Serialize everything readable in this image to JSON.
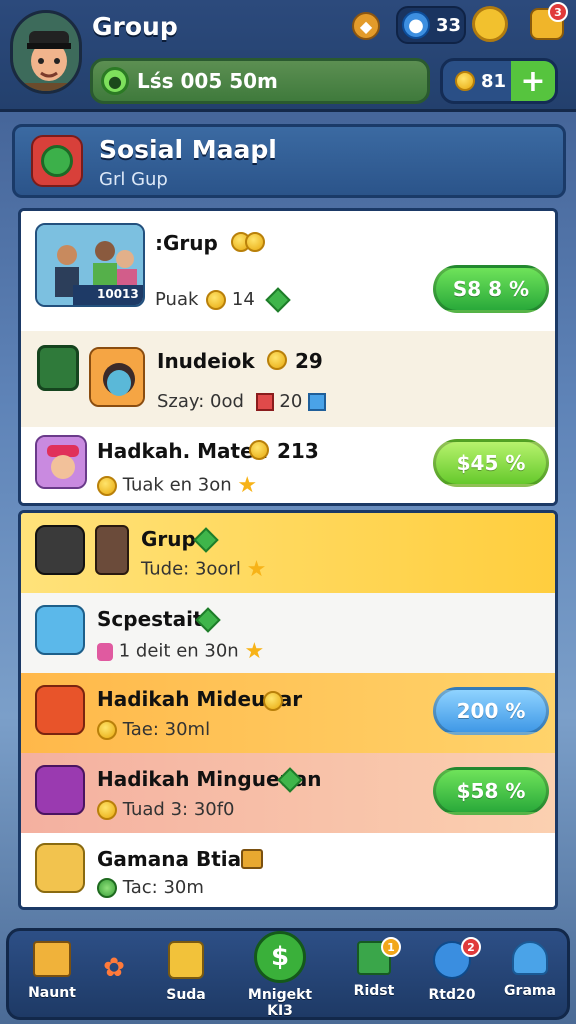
{
  "top": {
    "title": "Group",
    "gem_count": "33",
    "badge_count": "3",
    "search_text": "Lśs 005 50m",
    "gold_amount": "81",
    "plus_label": "+"
  },
  "header": {
    "title": "Sosial Maapl",
    "subtitle": "Grl Gup"
  },
  "list1": [
    {
      "title": ":Grup",
      "sub_prefix": "Puak",
      "sub_value": "14",
      "button": "S8 8 %",
      "picture_caption": "10013"
    },
    {
      "title": "Inudeiok",
      "title_value": "29",
      "sub_prefix": "Szay: 0od",
      "sub_value": "20",
      "button": ""
    },
    {
      "title": "Hadkah. Maten",
      "title_value": "213",
      "sub_text": "Tuak en 3on",
      "button": "$45 %"
    }
  ],
  "list2": [
    {
      "title": "Grup",
      "sub_text": "Tude: 3oorl"
    },
    {
      "title": "Scpestait",
      "sub_text": "1 deit en 30n"
    },
    {
      "title": "Hadikah Mideuaar",
      "sub_text": "Tae: 30ml",
      "button": "200 %"
    },
    {
      "title": "Hadikah Mingueuan",
      "sub_text": "Tuad 3: 30f0",
      "button": "$58 %"
    },
    {
      "title": "Gamana Btiarl",
      "sub_text": "Tac: 30m"
    }
  ],
  "nav": [
    {
      "label": "Naunt",
      "icon": "house-icon"
    },
    {
      "label": "",
      "icon": "paw-icon"
    },
    {
      "label": "Suda",
      "icon": "chest-icon"
    },
    {
      "label": "Mnigekt KI3",
      "icon": "money-icon"
    },
    {
      "label": "Ridst",
      "icon": "flag-icon",
      "badge": "1"
    },
    {
      "label": "Rtd20",
      "icon": "globe-icon",
      "badge": "2"
    },
    {
      "label": "Grama",
      "icon": "people-icon"
    }
  ],
  "colors": {
    "accent_green": "#29a93a",
    "accent_blue": "#3f98e6",
    "highlight_yellow": "#ffd24a",
    "highlight_orange": "#ffb45a",
    "nav_bg": "#1e3a66"
  }
}
